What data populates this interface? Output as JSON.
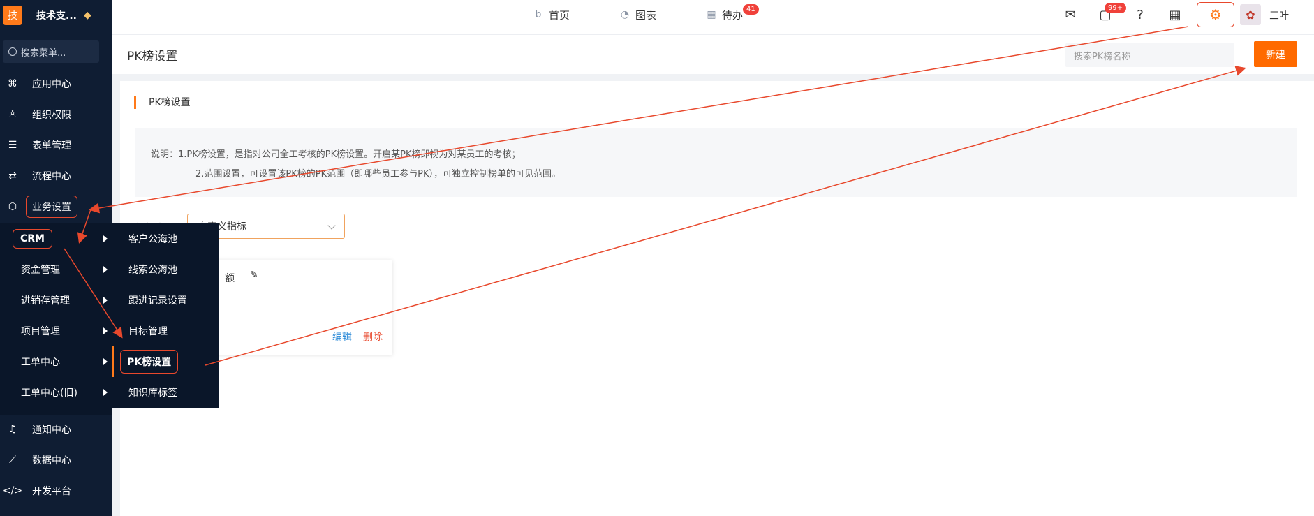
{
  "brand": {
    "logo_char": "技",
    "name": "技术支...",
    "gem_icon": "diamond-icon"
  },
  "sidebar": {
    "search_placeholder": "搜索菜单...",
    "items": [
      {
        "label": "应用中心",
        "icon": "apps-icon"
      },
      {
        "label": "组织权限",
        "icon": "user-icon"
      },
      {
        "label": "表单管理",
        "icon": "form-icon"
      },
      {
        "label": "流程中心",
        "icon": "flow-icon"
      },
      {
        "label": "业务设置",
        "icon": "cube-icon"
      },
      {
        "label": "通知中心",
        "icon": "bell-icon"
      },
      {
        "label": "数据中心",
        "icon": "chart-icon"
      },
      {
        "label": "开发平台",
        "icon": "code-icon"
      }
    ],
    "submenu": [
      "CRM",
      "资金管理",
      "进销存管理",
      "项目管理",
      "工单中心",
      "工单中心(旧)"
    ],
    "flyout": [
      "客户公海池",
      "线索公海池",
      "跟进记录设置",
      "目标管理",
      "PK榜设置",
      "知识库标签"
    ]
  },
  "topbar": {
    "tabs": [
      {
        "label": "首页",
        "icon": "home-icon"
      },
      {
        "label": "图表",
        "icon": "pie-icon"
      },
      {
        "label": "待办",
        "icon": "calendar-icon",
        "badge": "41"
      }
    ],
    "message_badge": "99+",
    "user_name": "三叶"
  },
  "page": {
    "title": "PK榜设置",
    "search_placeholder": "搜索PK榜名称",
    "new_button": "新建",
    "section_title": "PK榜设置",
    "desc_line1": "说明：1.PK榜设置，是指对公司全工考核的PK榜设置。开启某PK榜即视为对某员工的考核；",
    "desc_line2": "2.范围设置，可设置该PK榜的PK范围（即哪些员工参与PK），可独立控制榜单的可见范围。",
    "filter_label": "指标类型",
    "filter_value": "自定义指标",
    "card_title": "额",
    "card_edit": "编辑",
    "card_delete": "删除"
  },
  "colors": {
    "accent": "#ff6a00",
    "annotation": "#e8482c",
    "sidebar_bg": "#0f1d33"
  }
}
